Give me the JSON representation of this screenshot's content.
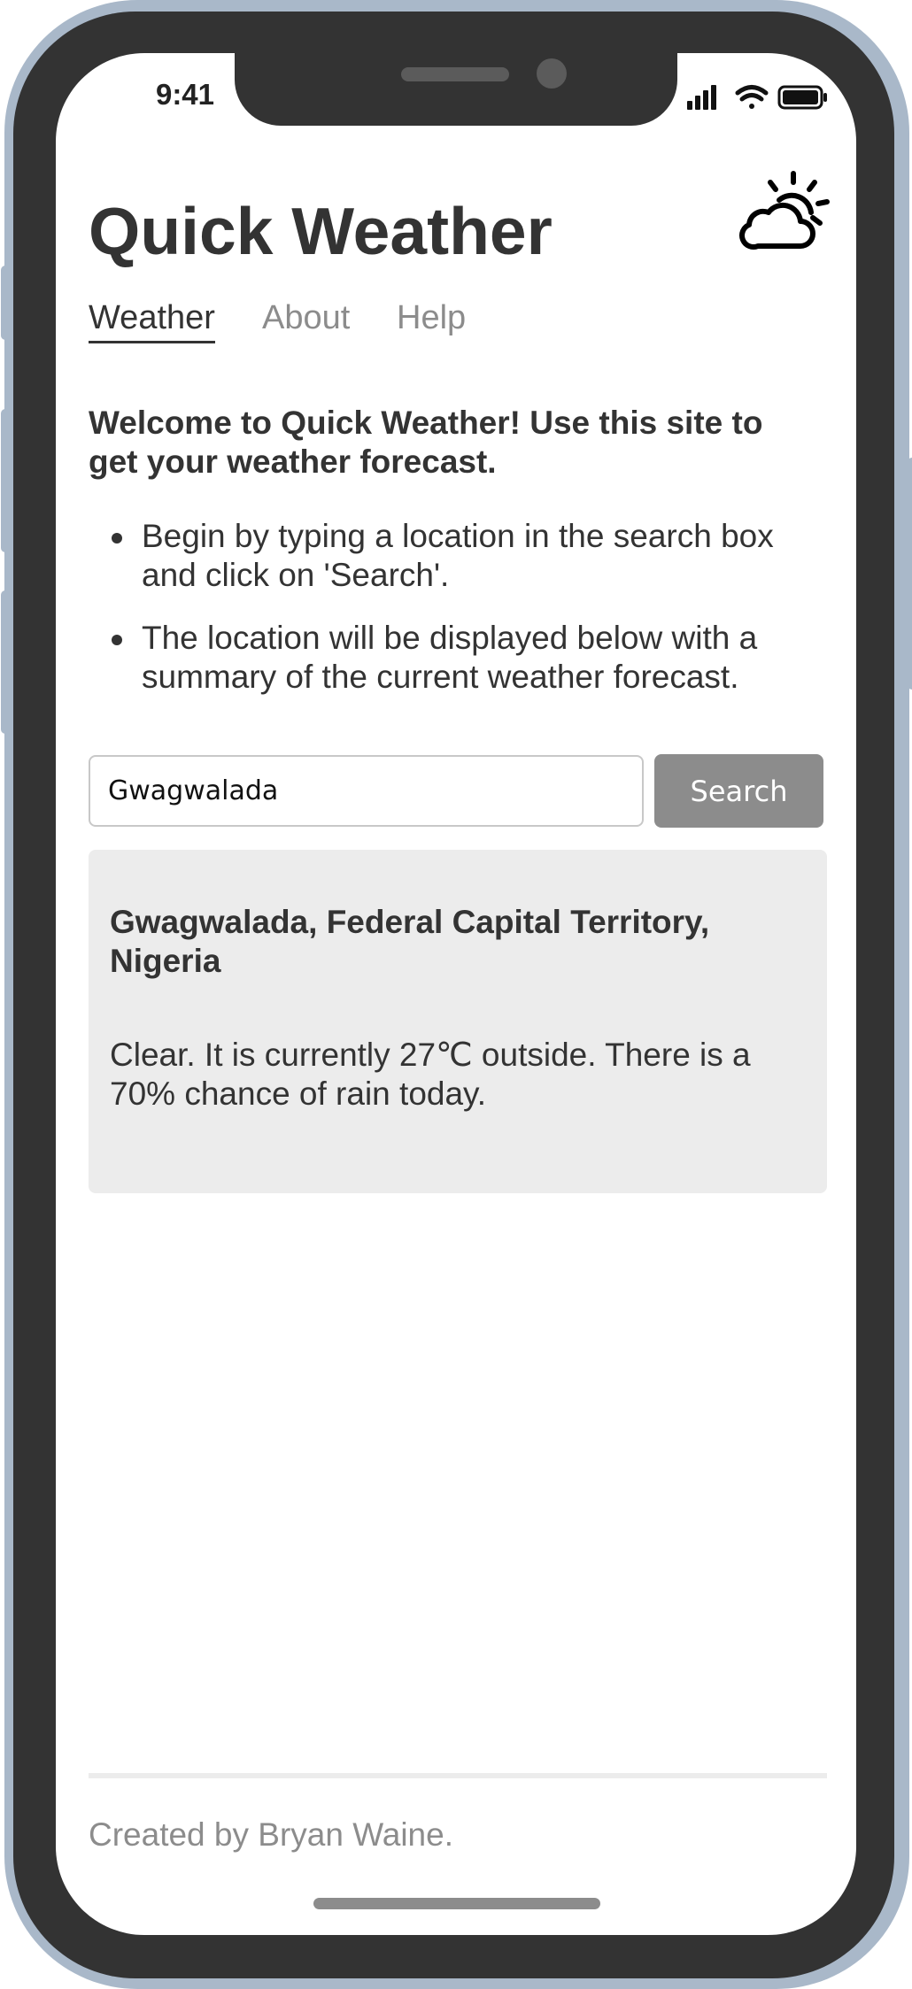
{
  "status_bar": {
    "time": "9:41",
    "icons": [
      "signal-icon",
      "wifi-icon",
      "battery-icon"
    ]
  },
  "header": {
    "title": "Quick Weather",
    "logo_icon": "partly-cloudy-icon"
  },
  "nav": {
    "items": [
      {
        "label": "Weather",
        "active": true
      },
      {
        "label": "About",
        "active": false
      },
      {
        "label": "Help",
        "active": false
      }
    ]
  },
  "intro": {
    "welcome": "Welcome to Quick Weather! Use this site to get your weather forecast.",
    "bullets": [
      "Begin by typing a location in the search box and click on 'Search'.",
      "The location will be displayed below with a summary of the current weather forecast."
    ]
  },
  "search": {
    "value": "Gwagwalada",
    "button_label": "Search"
  },
  "result": {
    "location": "Gwagwalada, Federal Capital Territory, Nigeria",
    "summary": "Clear. It is currently 27℃ outside. There is a 70% chance of rain today."
  },
  "footer": {
    "text": "Created by Bryan Waine."
  },
  "colors": {
    "frame": "#a9b8c9",
    "bezel": "#333333",
    "text": "#333333",
    "muted": "#8c8c8c",
    "card": "#ececec"
  }
}
